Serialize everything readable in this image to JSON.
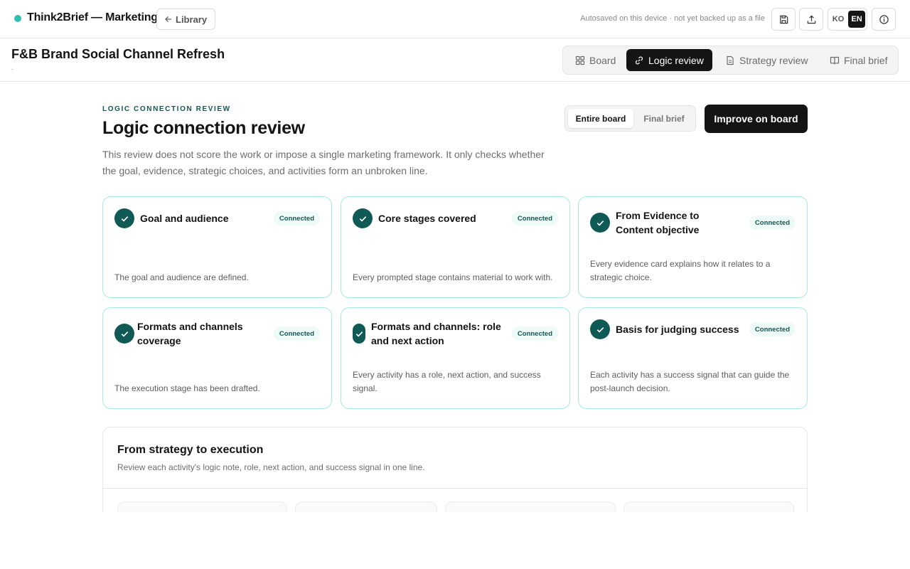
{
  "app": {
    "title": "Think2Brief — Marketing",
    "library_label": "Library",
    "autosave_text": "Autosaved on this device · not yet backed up as a file",
    "languages": [
      "KO",
      "EN"
    ],
    "active_language": "EN"
  },
  "project": {
    "title": "F&B Brand Social Channel Refresh",
    "subtitle": "-"
  },
  "tabs": [
    {
      "label": "Board",
      "icon": "grid-icon"
    },
    {
      "label": "Logic review",
      "icon": "link-icon",
      "active": true
    },
    {
      "label": "Strategy review",
      "icon": "document-icon"
    },
    {
      "label": "Final brief",
      "icon": "book-icon"
    }
  ],
  "review": {
    "eyebrow": "LOGIC CONNECTION REVIEW",
    "title": "Logic connection review",
    "description": "This review does not score the work or impose a single marketing framework. It only checks whether the goal, evidence, strategic choices, and activities form an unbroken line.",
    "scope_options": [
      "Entire board",
      "Final brief"
    ],
    "active_scope": "Entire board",
    "improve_label": "Improve on board"
  },
  "cards": [
    {
      "title": "Goal and audience",
      "status": "Connected",
      "description": "The goal and audience are defined."
    },
    {
      "title": "Core stages covered",
      "status": "Connected",
      "description": "Every prompted stage contains material to work with."
    },
    {
      "title": "From Evidence to Content objective",
      "status": "Connected",
      "description": "Every evidence card explains how it relates to a strategic choice."
    },
    {
      "title": "Formats and channels coverage",
      "status": "Connected",
      "description": "The execution stage has been drafted."
    },
    {
      "title": "Formats and channels: role and next action",
      "status": "Connected",
      "description": "Every activity has a role, next action, and success signal."
    },
    {
      "title": "Basis for judging success",
      "status": "Connected",
      "description": "Each activity has a success signal that can guide the post-launch decision."
    }
  ],
  "strategy_section": {
    "title": "From strategy to execution",
    "description": "Review each activity's logic note, role, next action, and success signal in one line."
  },
  "colors": {
    "accent": "#0f5a55",
    "brand_dot": "#2fbfb0",
    "card_border": "#a6ebe0",
    "dark": "#141414"
  }
}
